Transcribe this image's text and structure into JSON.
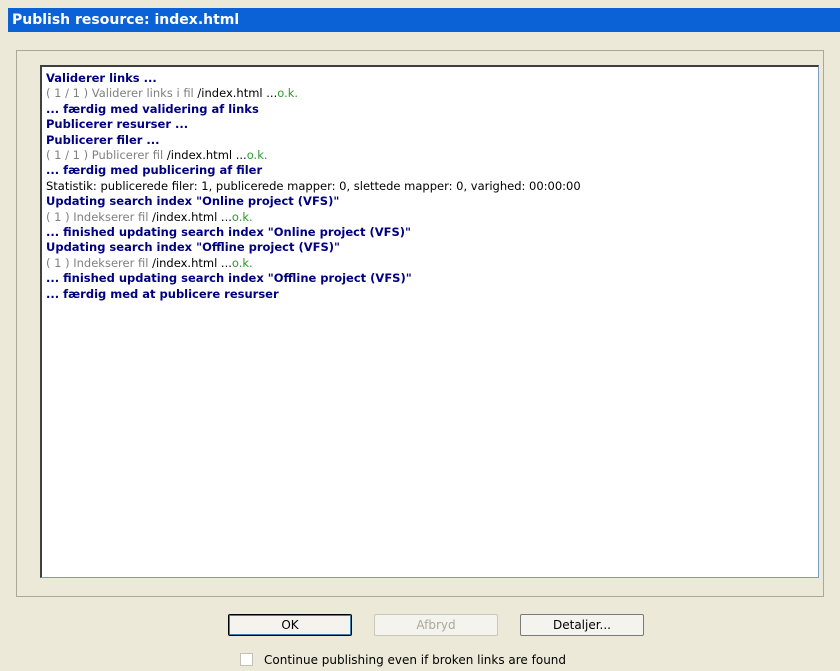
{
  "window": {
    "title": "Publish resource: index.html"
  },
  "log": [
    {
      "parts": [
        {
          "text": "Validerer links ...",
          "style": "h"
        }
      ]
    },
    {
      "parts": [
        {
          "text": "( 1 / 1 ) Validerer links i fil ",
          "style": "g"
        },
        {
          "text": "/index.html ...",
          "style": "k"
        },
        {
          "text": "o.k.",
          "style": "ok"
        }
      ]
    },
    {
      "parts": [
        {
          "text": "... færdig med validering af links",
          "style": "h"
        }
      ]
    },
    {
      "parts": [
        {
          "text": "Publicerer resurser ...",
          "style": "h"
        }
      ]
    },
    {
      "parts": [
        {
          "text": "Publicerer filer ...",
          "style": "h"
        }
      ]
    },
    {
      "parts": [
        {
          "text": "( 1 / 1 ) Publicerer fil ",
          "style": "g"
        },
        {
          "text": "/index.html ...",
          "style": "k"
        },
        {
          "text": "o.k.",
          "style": "ok"
        }
      ]
    },
    {
      "parts": [
        {
          "text": "... færdig med publicering af filer",
          "style": "h"
        }
      ]
    },
    {
      "parts": [
        {
          "text": "Statistik: publicerede filer: 1, publicerede mapper: 0, slettede mapper: 0, varighed: 00:00:00",
          "style": "k"
        }
      ]
    },
    {
      "parts": [
        {
          "text": "Updating search index \"Online project (VFS)\"",
          "style": "h"
        }
      ]
    },
    {
      "parts": [
        {
          "text": "( 1 ) Indekserer fil ",
          "style": "g"
        },
        {
          "text": "/index.html ...",
          "style": "k"
        },
        {
          "text": "o.k.",
          "style": "ok"
        }
      ]
    },
    {
      "parts": [
        {
          "text": "... finished updating search index \"Online project (VFS)\"",
          "style": "h"
        }
      ]
    },
    {
      "parts": [
        {
          "text": "Updating search index \"Offline project (VFS)\"",
          "style": "h"
        }
      ]
    },
    {
      "parts": [
        {
          "text": "( 1 ) Indekserer fil ",
          "style": "g"
        },
        {
          "text": "/index.html ...",
          "style": "k"
        },
        {
          "text": "o.k.",
          "style": "ok"
        }
      ]
    },
    {
      "parts": [
        {
          "text": "... finished updating search index \"Offline project (VFS)\"",
          "style": "h"
        }
      ]
    },
    {
      "parts": [
        {
          "text": "... færdig med at publicere resurser",
          "style": "h"
        }
      ]
    }
  ],
  "buttons": {
    "ok": "OK",
    "cancel": "Afbryd",
    "details": "Detaljer..."
  },
  "checkbox": {
    "label": "Continue publishing even if broken links are found",
    "checked": false
  },
  "colors": {
    "title_bar": "#0b62d6",
    "heading_text": "#000080",
    "ok_text": "#2e9a2e",
    "muted_text": "#808080"
  }
}
